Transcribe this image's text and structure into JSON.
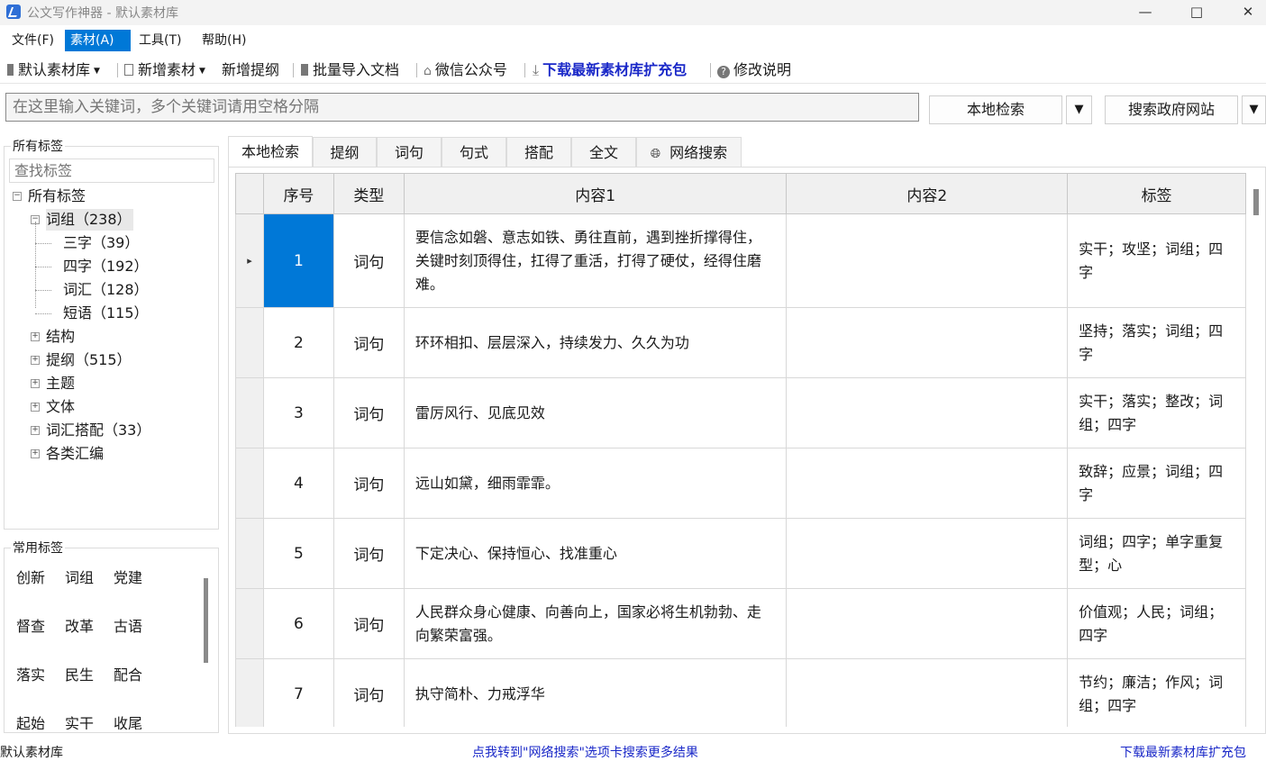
{
  "window": {
    "title": "公文写作神器 - 默认素材库",
    "minimize_icon": "minimize-icon",
    "maximize_icon": "maximize-icon",
    "close_icon": "close-icon"
  },
  "menu": [
    "文件(F)",
    "素材(A)",
    "工具(T)",
    "帮助(H)"
  ],
  "menu_active_index": 1,
  "toolbar": {
    "library": "默认素材库",
    "add_material": "新增素材",
    "add_outline": "新增提纲",
    "batch_import": "批量导入文档",
    "wechat": "微信公众号",
    "download": "下载最新素材库扩充包",
    "changelog": "修改说明"
  },
  "search": {
    "placeholder": "在这里输入关键词，多个关键词请用空格分隔",
    "local_button": "本地检索",
    "gov_button": "搜索政府网站",
    "dropdown_glyph": "▼"
  },
  "left_panel": {
    "all_tags_title": "所有标签",
    "tag_search_placeholder": "查找标签",
    "tree": [
      {
        "label": "所有标签",
        "level": 0,
        "exp": "⊟"
      },
      {
        "label": "词组（238）",
        "level": 1,
        "exp": "⊟",
        "selected": true
      },
      {
        "label": "三字（39）",
        "level": 2
      },
      {
        "label": "四字（192）",
        "level": 2
      },
      {
        "label": "词汇（128）",
        "level": 2
      },
      {
        "label": "短语（115）",
        "level": 2
      },
      {
        "label": "结构",
        "level": 1,
        "exp": "⊞"
      },
      {
        "label": "提纲（515）",
        "level": 1,
        "exp": "⊞"
      },
      {
        "label": "主题",
        "level": 1,
        "exp": "⊞"
      },
      {
        "label": "文体",
        "level": 1,
        "exp": "⊞"
      },
      {
        "label": "词汇搭配（33）",
        "level": 1,
        "exp": "⊞"
      },
      {
        "label": "各类汇编",
        "level": 1,
        "exp": "⊞"
      }
    ],
    "common_tags_title": "常用标签",
    "common_tags": [
      [
        "创新",
        "词组",
        "党建"
      ],
      [
        "督查",
        "改革",
        "古语"
      ],
      [
        "落实",
        "民生",
        "配合"
      ],
      [
        "起始",
        "实干",
        "收尾"
      ]
    ]
  },
  "tabs": [
    "本地检索",
    "提纲",
    "词句",
    "句式",
    "搭配",
    "全文",
    "网络搜索"
  ],
  "tabs_active_index": 0,
  "globe_icon": "globe-icon",
  "table": {
    "headers": [
      "序号",
      "类型",
      "内容1",
      "内容2",
      "标签"
    ],
    "row_indicator": "▸",
    "rows": [
      {
        "num": "1",
        "type": "词句",
        "content1": "要信念如磐、意志如铁、勇往直前，遇到挫折撑得住，关键时刻顶得住，扛得了重活，打得了硬仗，经得住磨难。",
        "content2": "",
        "tags": "实干；攻坚；词组；四字"
      },
      {
        "num": "2",
        "type": "词句",
        "content1": "环环相扣、层层深入，持续发力、久久为功",
        "content2": "",
        "tags": "坚持；落实；词组；四字"
      },
      {
        "num": "3",
        "type": "词句",
        "content1": "雷厉风行、见底见效",
        "content2": "",
        "tags": "实干；落实；整改；词组；四字"
      },
      {
        "num": "4",
        "type": "词句",
        "content1": "远山如黛，细雨霏霏。",
        "content2": "",
        "tags": "致辞；应景；词组；四字"
      },
      {
        "num": "5",
        "type": "词句",
        "content1": "下定决心、保持恒心、找准重心",
        "content2": "",
        "tags": "词组；四字；单字重复型；心"
      },
      {
        "num": "6",
        "type": "词句",
        "content1": "人民群众身心健康、向善向上，国家必将生机勃勃、走向繁荣富强。",
        "content2": "",
        "tags": "价值观；人民；词组；四字"
      },
      {
        "num": "7",
        "type": "词句",
        "content1": "执守简朴、力戒浮华",
        "content2": "",
        "tags": "节约；廉洁；作风；词组；四字"
      }
    ]
  },
  "status": {
    "left": "默认素材库",
    "center": "点我转到\"网络搜索\"选项卡搜索更多结果",
    "right": "下载最新素材库扩充包"
  },
  "colors": {
    "accent": "#0078d7",
    "link": "#1a28c8"
  }
}
